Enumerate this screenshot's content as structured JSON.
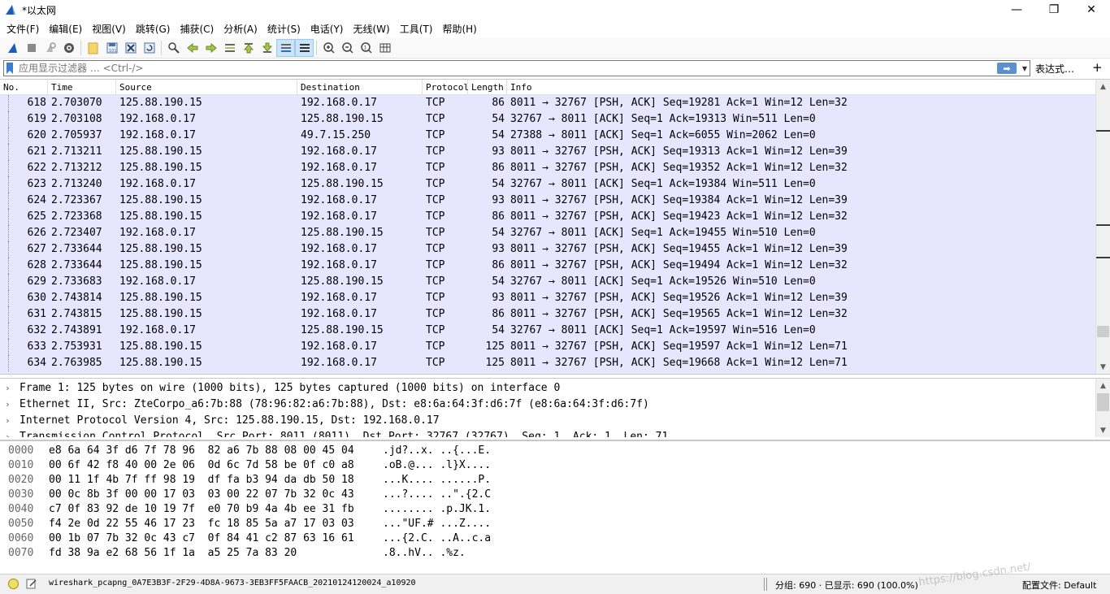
{
  "window": {
    "title": "*以太网",
    "minimize": "—",
    "maximize": "❐",
    "close": "✕"
  },
  "menu": [
    "文件(F)",
    "编辑(E)",
    "视图(V)",
    "跳转(G)",
    "捕获(C)",
    "分析(A)",
    "统计(S)",
    "电话(Y)",
    "无线(W)",
    "工具(T)",
    "帮助(H)"
  ],
  "toolbar": {
    "icons": [
      "shark-fin-start-icon",
      "stop-icon",
      "restart-icon",
      "options-gear-icon",
      "open-folder-icon",
      "save-icon",
      "close-file-icon",
      "reload-icon",
      "find-icon",
      "back-arrow-icon",
      "forward-arrow-icon",
      "goto-packet-icon",
      "first-packet-icon",
      "last-packet-icon",
      "autoscroll-icon",
      "colorize-icon",
      "zoom-in-icon",
      "zoom-out-icon",
      "zoom-normal-icon",
      "resize-columns-icon"
    ]
  },
  "filter": {
    "placeholder": "应用显示过滤器 … <Ctrl-/>",
    "expression_label": "表达式…",
    "apply_arrow": "➡",
    "add_label": "+"
  },
  "packet_list": {
    "columns": {
      "no": "No.",
      "time": "Time",
      "source": "Source",
      "destination": "Destination",
      "protocol": "Protocol",
      "length": "Length",
      "info": "Info"
    },
    "rows": [
      {
        "no": "618",
        "time": "2.703070",
        "src": "125.88.190.15",
        "dst": "192.168.0.17",
        "proto": "TCP",
        "len": "86",
        "info": "8011 → 32767 [PSH, ACK] Seq=19281 Ack=1 Win=12 Len=32"
      },
      {
        "no": "619",
        "time": "2.703108",
        "src": "192.168.0.17",
        "dst": "125.88.190.15",
        "proto": "TCP",
        "len": "54",
        "info": "32767 → 8011 [ACK] Seq=1 Ack=19313 Win=511 Len=0"
      },
      {
        "no": "620",
        "time": "2.705937",
        "src": "192.168.0.17",
        "dst": "49.7.15.250",
        "proto": "TCP",
        "len": "54",
        "info": "27388 → 8011 [ACK] Seq=1 Ack=6055 Win=2062 Len=0"
      },
      {
        "no": "621",
        "time": "2.713211",
        "src": "125.88.190.15",
        "dst": "192.168.0.17",
        "proto": "TCP",
        "len": "93",
        "info": "8011 → 32767 [PSH, ACK] Seq=19313 Ack=1 Win=12 Len=39"
      },
      {
        "no": "622",
        "time": "2.713212",
        "src": "125.88.190.15",
        "dst": "192.168.0.17",
        "proto": "TCP",
        "len": "86",
        "info": "8011 → 32767 [PSH, ACK] Seq=19352 Ack=1 Win=12 Len=32"
      },
      {
        "no": "623",
        "time": "2.713240",
        "src": "192.168.0.17",
        "dst": "125.88.190.15",
        "proto": "TCP",
        "len": "54",
        "info": "32767 → 8011 [ACK] Seq=1 Ack=19384 Win=511 Len=0"
      },
      {
        "no": "624",
        "time": "2.723367",
        "src": "125.88.190.15",
        "dst": "192.168.0.17",
        "proto": "TCP",
        "len": "93",
        "info": "8011 → 32767 [PSH, ACK] Seq=19384 Ack=1 Win=12 Len=39"
      },
      {
        "no": "625",
        "time": "2.723368",
        "src": "125.88.190.15",
        "dst": "192.168.0.17",
        "proto": "TCP",
        "len": "86",
        "info": "8011 → 32767 [PSH, ACK] Seq=19423 Ack=1 Win=12 Len=32"
      },
      {
        "no": "626",
        "time": "2.723407",
        "src": "192.168.0.17",
        "dst": "125.88.190.15",
        "proto": "TCP",
        "len": "54",
        "info": "32767 → 8011 [ACK] Seq=1 Ack=19455 Win=510 Len=0"
      },
      {
        "no": "627",
        "time": "2.733644",
        "src": "125.88.190.15",
        "dst": "192.168.0.17",
        "proto": "TCP",
        "len": "93",
        "info": "8011 → 32767 [PSH, ACK] Seq=19455 Ack=1 Win=12 Len=39"
      },
      {
        "no": "628",
        "time": "2.733644",
        "src": "125.88.190.15",
        "dst": "192.168.0.17",
        "proto": "TCP",
        "len": "86",
        "info": "8011 → 32767 [PSH, ACK] Seq=19494 Ack=1 Win=12 Len=32"
      },
      {
        "no": "629",
        "time": "2.733683",
        "src": "192.168.0.17",
        "dst": "125.88.190.15",
        "proto": "TCP",
        "len": "54",
        "info": "32767 → 8011 [ACK] Seq=1 Ack=19526 Win=510 Len=0"
      },
      {
        "no": "630",
        "time": "2.743814",
        "src": "125.88.190.15",
        "dst": "192.168.0.17",
        "proto": "TCP",
        "len": "93",
        "info": "8011 → 32767 [PSH, ACK] Seq=19526 Ack=1 Win=12 Len=39"
      },
      {
        "no": "631",
        "time": "2.743815",
        "src": "125.88.190.15",
        "dst": "192.168.0.17",
        "proto": "TCP",
        "len": "86",
        "info": "8011 → 32767 [PSH, ACK] Seq=19565 Ack=1 Win=12 Len=32"
      },
      {
        "no": "632",
        "time": "2.743891",
        "src": "192.168.0.17",
        "dst": "125.88.190.15",
        "proto": "TCP",
        "len": "54",
        "info": "32767 → 8011 [ACK] Seq=1 Ack=19597 Win=516 Len=0"
      },
      {
        "no": "633",
        "time": "2.753931",
        "src": "125.88.190.15",
        "dst": "192.168.0.17",
        "proto": "TCP",
        "len": "125",
        "info": "8011 → 32767 [PSH, ACK] Seq=19597 Ack=1 Win=12 Len=71"
      },
      {
        "no": "634",
        "time": "2.763985",
        "src": "125.88.190.15",
        "dst": "192.168.0.17",
        "proto": "TCP",
        "len": "125",
        "info": "8011 → 32767 [PSH, ACK] Seq=19668 Ack=1 Win=12 Len=71"
      }
    ]
  },
  "details": [
    {
      "arrow": "›",
      "text": "Frame 1: 125 bytes on wire (1000 bits), 125 bytes captured (1000 bits) on interface 0"
    },
    {
      "arrow": "›",
      "text": "Ethernet II, Src: ZteCorpo_a6:7b:88 (78:96:82:a6:7b:88), Dst: e8:6a:64:3f:d6:7f (e8:6a:64:3f:d6:7f)"
    },
    {
      "arrow": "›",
      "text": "Internet Protocol Version 4, Src: 125.88.190.15, Dst: 192.168.0.17"
    },
    {
      "arrow": "›",
      "text": "Transmission Control Protocol, Src Port: 8011 (8011), Dst Port: 32767 (32767), Seq: 1, Ack: 1, Len: 71"
    }
  ],
  "hex": [
    {
      "off": "0000",
      "bytes": "e8 6a 64 3f d6 7f 78 96  82 a6 7b 88 08 00 45 04",
      "ascii": ".jd?..x. ..{...E."
    },
    {
      "off": "0010",
      "bytes": "00 6f 42 f8 40 00 2e 06  0d 6c 7d 58 be 0f c0 a8",
      "ascii": ".oB.@... .l}X...."
    },
    {
      "off": "0020",
      "bytes": "00 11 1f 4b 7f ff 98 19  df fa b3 94 da db 50 18",
      "ascii": "...K.... ......P."
    },
    {
      "off": "0030",
      "bytes": "00 0c 8b 3f 00 00 17 03  03 00 22 07 7b 32 0c 43",
      "ascii": "...?.... ..\".{2.C"
    },
    {
      "off": "0040",
      "bytes": "c7 0f 83 92 de 10 19 7f  e0 70 b9 4a 4b ee 31 fb",
      "ascii": "........ .p.JK.1."
    },
    {
      "off": "0050",
      "bytes": "f4 2e 0d 22 55 46 17 23  fc 18 85 5a a7 17 03 03",
      "ascii": "...\"UF.# ...Z...."
    },
    {
      "off": "0060",
      "bytes": "00 1b 07 7b 32 0c 43 c7  0f 84 41 c2 87 63 16 61",
      "ascii": "...{2.C. ..A..c.a"
    },
    {
      "off": "0070",
      "bytes": "fd 38 9a e2 68 56 1f 1a  a5 25 7a 83 20",
      "ascii": ".8..hV.. .%z."
    }
  ],
  "status": {
    "file": "wireshark_pcapng_0A7E3B3F-2F29-4D8A-9673-3EB3FF5FAACB_20210124120024_a10920",
    "stats": "分组: 690 · 已显示: 690 (100.0%)",
    "profile": "配置文件: Default",
    "watermark": "https://blog.csdn.net/"
  },
  "colors": {
    "row_bg": "#e7e6ff",
    "accent": "#3c7dd1"
  }
}
